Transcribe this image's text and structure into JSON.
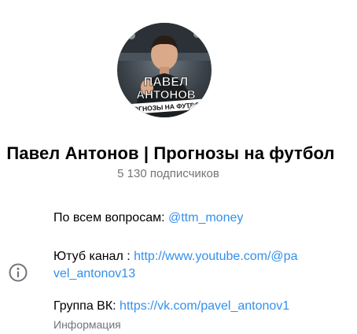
{
  "channel": {
    "title": "Павел Антонов | Прогнозы на футбол",
    "subscribers": "5 130 подписчиков",
    "avatar_text": {
      "name_line1": "ПАВЕЛ",
      "name_line2": "АНТОНОВ",
      "banner": "ПРОГНОЗЫ НА ФУТБОЛ"
    }
  },
  "description": {
    "line1_text": "По всем вопросам: ",
    "line1_link": "@ttm_money",
    "line2_text": "Ютуб канал : ",
    "line2_link_part1": "http://www.youtube.com/@pa",
    "line2_link_part2": "vel_antonov13",
    "line3_text": "Группа ВК: ",
    "line3_link": "https://vk.com/pavel_antonov1",
    "label": "Информация"
  },
  "colors": {
    "link": "#3390ec",
    "secondary_text": "#707579",
    "icon": "#707579"
  },
  "icons": {
    "info": "info-circle-icon"
  }
}
